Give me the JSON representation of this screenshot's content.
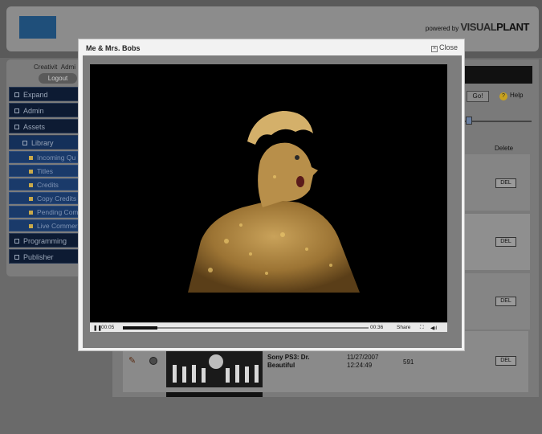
{
  "header": {
    "powered_label": "powered by",
    "brand_a": "VISUAL",
    "brand_b": "PLANT"
  },
  "user": {
    "name": "Creativit",
    "role": "Admi",
    "logout_label": "Logout"
  },
  "nav": {
    "items": [
      {
        "label": "Expand"
      },
      {
        "label": "Admin"
      },
      {
        "label": "Assets"
      }
    ],
    "library": "Library",
    "library_items": [
      {
        "label": "Incoming Qu"
      },
      {
        "label": "Titles"
      },
      {
        "label": "Credits"
      },
      {
        "label": "Copy Credits"
      },
      {
        "label": "Pending Com"
      },
      {
        "label": "Live Commer"
      }
    ],
    "bottom_items": [
      {
        "label": "Programming"
      },
      {
        "label": "Publisher"
      }
    ]
  },
  "toolbar": {
    "go_label": "Go!",
    "help_label": "Help"
  },
  "table": {
    "delete_header": "Delete",
    "del_label": "DEL",
    "row": {
      "title": "Sony PS3: Dr. Beautiful",
      "date": "11/27/2007",
      "time": "12:24:49",
      "count": "591"
    }
  },
  "modal": {
    "title": "Me & Mrs. Bobs",
    "close_label": "Close",
    "player": {
      "current_time": "00:05",
      "duration": "00:36",
      "progress": 0.14,
      "share_label": "Share"
    }
  },
  "colors": {
    "nav_bg": "#0d1b33",
    "accent_gold": "#c9a94a",
    "video_bg": "#000000"
  }
}
